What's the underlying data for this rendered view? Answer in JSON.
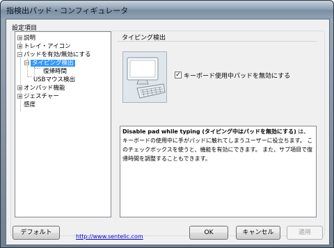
{
  "window": {
    "title": "指検出パッド・コンフィギュレータ"
  },
  "settings": {
    "label": "設定項目"
  },
  "tree": {
    "items": [
      {
        "label": "説明",
        "expander": "⊞"
      },
      {
        "label": "トレイ・アイコン",
        "expander": "⊞"
      },
      {
        "label": "パッドを有効/無効にする",
        "expander": "⊟"
      },
      {
        "label": "タイピング検出",
        "expander": "⊟"
      },
      {
        "label": "復帰時間",
        "expander": ""
      },
      {
        "label": "USBマウス検出",
        "expander": ""
      },
      {
        "label": "オンパッド機能",
        "expander": "⊞"
      },
      {
        "label": "ジェスチャー",
        "expander": "⊞"
      },
      {
        "label": "感度",
        "expander": ""
      }
    ]
  },
  "panel": {
    "title": "タイピング検出",
    "checkbox_label": "キーボード使用中パッドを無効にする",
    "checkbox_checked": "✓"
  },
  "description": {
    "bold": "Disable pad while typing (タイピング中はパッドを無効にする)",
    "text": " は、キーボードの使用中に手がパッドに触れてしまうユーザーに役立ちます。 このチェックボックスを使うと、機能を有効にできます。 また、サブ項目で復帰時間を調整することもできます。"
  },
  "footer": {
    "default_button": "デフォルト",
    "link": "http://www.sentelic.com",
    "ok_button": "OK",
    "cancel_button": "キャンセル",
    "apply_button": "適用"
  }
}
